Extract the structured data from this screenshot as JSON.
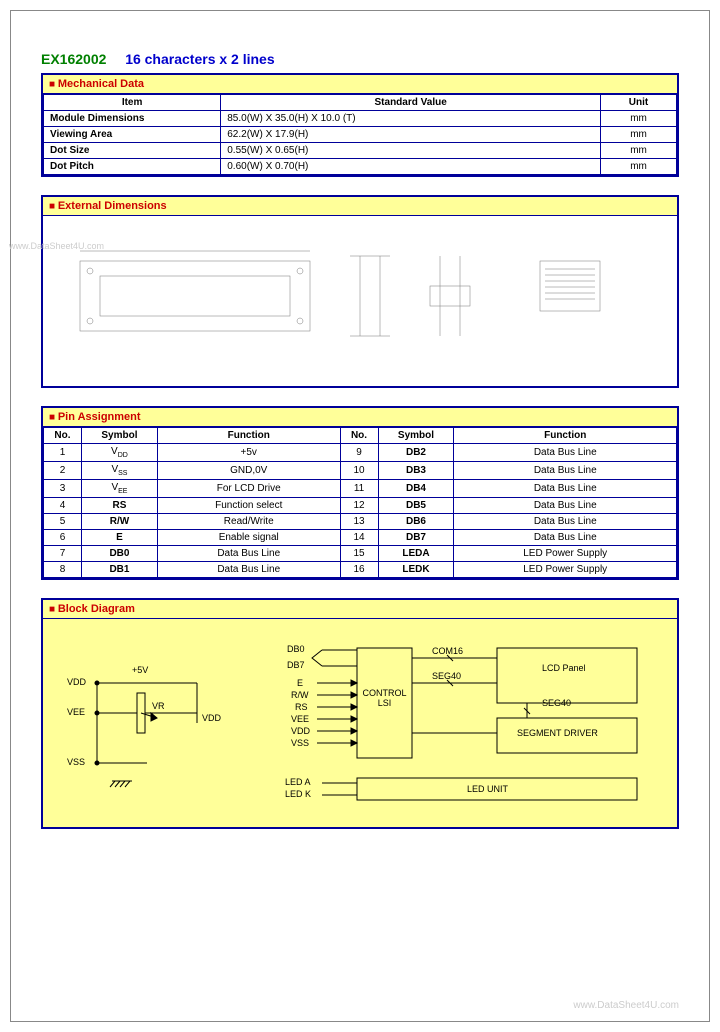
{
  "title": {
    "part": "EX162002",
    "desc": "16 characters x 2 lines"
  },
  "sections": {
    "mechanical": {
      "header": "Mechanical Data",
      "cols": [
        "Item",
        "Standard Value",
        "Unit"
      ],
      "rows": [
        {
          "item": "Module Dimensions",
          "value": "85.0(W) X 35.0(H) X 10.0 (T)",
          "unit": "mm"
        },
        {
          "item": "Viewing Area",
          "value": "62.2(W) X 17.9(H)",
          "unit": "mm"
        },
        {
          "item": "Dot Size",
          "value": "0.55(W) X 0.65(H)",
          "unit": "mm"
        },
        {
          "item": "Dot Pitch",
          "value": "0.60(W) X 0.70(H)",
          "unit": "mm"
        }
      ]
    },
    "external": {
      "header": "External Dimensions"
    },
    "pins": {
      "header": "Pin Assignment",
      "cols": [
        "No.",
        "Symbol",
        "Function",
        "No.",
        "Symbol",
        "Function"
      ],
      "rows": [
        {
          "n1": "1",
          "s1": "V_DD",
          "f1": "+5v",
          "n2": "9",
          "s2": "DB2",
          "f2": "Data Bus Line"
        },
        {
          "n1": "2",
          "s1": "V_SS",
          "f1": "GND,0V",
          "n2": "10",
          "s2": "DB3",
          "f2": "Data Bus Line"
        },
        {
          "n1": "3",
          "s1": "V_EE",
          "f1": "For LCD Drive",
          "n2": "11",
          "s2": "DB4",
          "f2": "Data Bus Line"
        },
        {
          "n1": "4",
          "s1": "RS",
          "f1": "Function select",
          "n2": "12",
          "s2": "DB5",
          "f2": "Data Bus Line"
        },
        {
          "n1": "5",
          "s1": "R/W",
          "f1": "Read/Write",
          "n2": "13",
          "s2": "DB6",
          "f2": "Data Bus Line"
        },
        {
          "n1": "6",
          "s1": "E",
          "f1": "Enable signal",
          "n2": "14",
          "s2": "DB7",
          "f2": "Data Bus Line"
        },
        {
          "n1": "7",
          "s1": "DB0",
          "f1": "Data Bus Line",
          "n2": "15",
          "s2": "LEDA",
          "f2": "LED Power Supply"
        },
        {
          "n1": "8",
          "s1": "DB1",
          "f1": "Data Bus Line",
          "n2": "16",
          "s2": "LEDK",
          "f2": "LED Power Supply"
        }
      ]
    },
    "block": {
      "header": "Block Diagram",
      "circuit": {
        "p5v": "+5V",
        "vdd": "VDD",
        "vee": "VEE",
        "vss": "VSS",
        "vr": "VR",
        "vdd2": "VDD"
      },
      "diagram": {
        "db0": "DB0",
        "db7": "DB7",
        "e": "E",
        "rw": "R/W",
        "rs": "RS",
        "vee": "VEE",
        "vdd": "VDD",
        "vss": "VSS",
        "control": "CONTROL LSI",
        "com16": "COM16",
        "seg40a": "SEG40",
        "seg40b": "SEG40",
        "lcdpanel": "LCD Panel",
        "segdriver": "SEGMENT   DRIVER",
        "leda": "LED A",
        "ledk": "LED K",
        "ledunit": "LED UNIT"
      }
    }
  },
  "watermarks": {
    "left": "www.DataSheet4U.com",
    "bottom": "www.DataSheet4U.com"
  }
}
